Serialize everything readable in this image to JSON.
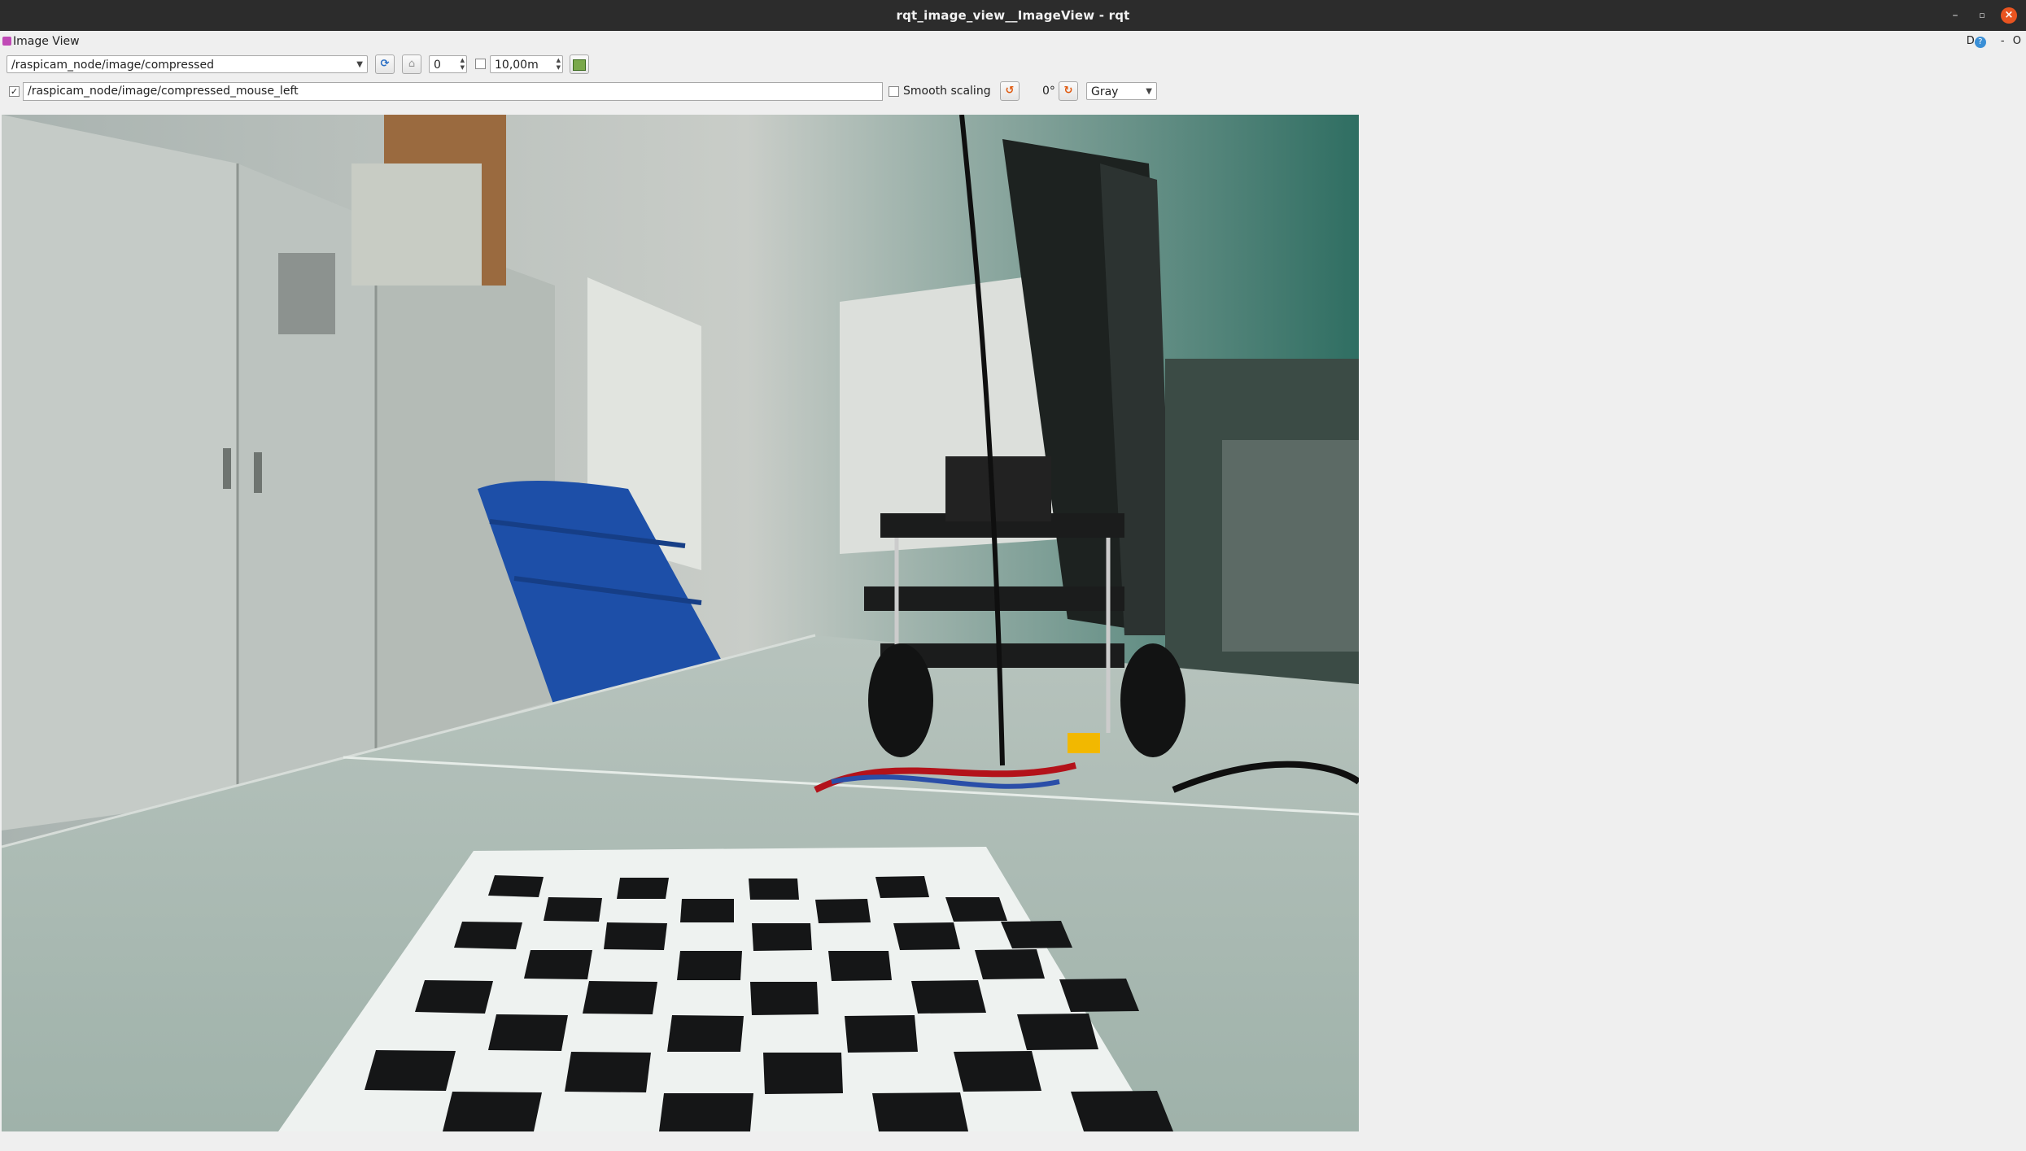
{
  "window": {
    "title": "rqt_image_view__ImageView - rqt",
    "minimize_glyph": "–",
    "maximize_glyph": "▫",
    "close_glyph": "×"
  },
  "plugin": {
    "title": "Image View",
    "dock_buttons": [
      "D",
      "?",
      "-",
      "O"
    ]
  },
  "toolbar": {
    "topic": "/raspicam_node/image/compressed",
    "zoom_value": "0",
    "time_checked": false,
    "time_value": "10,00m"
  },
  "toolbar2": {
    "publish_checked": true,
    "publish_topic": "/raspicam_node/image/compressed_mouse_left",
    "smooth_scaling_label": "Smooth scaling",
    "smooth_scaling_checked": false,
    "rotation_label": "0°",
    "colormap": "Gray"
  },
  "icons": {
    "refresh": "refresh-icon",
    "zoom1": "zoom-original-icon",
    "save": "save-image-icon",
    "rotate_left": "rotate-left-icon",
    "rotate_right": "rotate-right-icon"
  },
  "image": {
    "description_kind": "camera-feed",
    "accent": "#2b6fc4"
  }
}
